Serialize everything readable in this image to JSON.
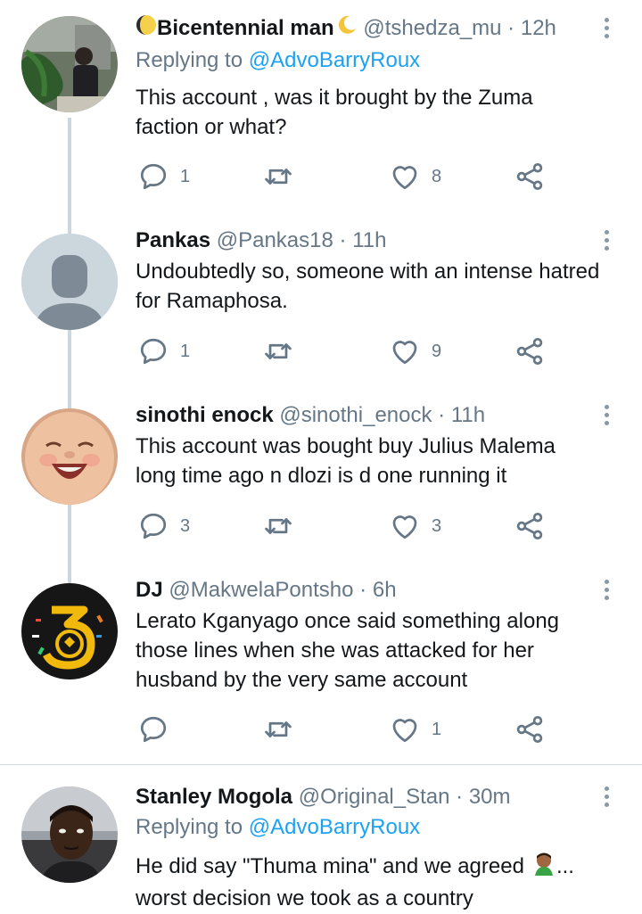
{
  "tweets": [
    {
      "name": "Bicentennial man",
      "name_prefix_icon": "yellow-half-moon-icon",
      "name_suffix_icon": "crescent-moon-icon",
      "handle": "@tshedza_mu",
      "time": "12h",
      "replying_label": "Replying to",
      "replying_to": "@AdvoBarryRoux",
      "text": "This account , was it brought by the Zuma faction or what?",
      "reply_count": "1",
      "retweet_count": "",
      "like_count": "8"
    },
    {
      "name": "Pankas",
      "handle": "@Pankas18",
      "time": "11h",
      "text": "Undoubtedly so, someone with an intense hatred for Ramaphosa.",
      "reply_count": "1",
      "retweet_count": "",
      "like_count": "9"
    },
    {
      "name": "sinothi enock",
      "handle": "@sinothi_enock",
      "time": "11h",
      "text": "This account was bought buy Julius Malema long time ago n dlozi is d one running it",
      "reply_count": "3",
      "retweet_count": "",
      "like_count": "3"
    },
    {
      "name": "DJ",
      "handle": "@MakwelaPontsho",
      "time": "6h",
      "text": "Lerato Kganyago once said something along those lines when she was attacked for her husband by the very same account",
      "reply_count": "",
      "retweet_count": "",
      "like_count": "1"
    },
    {
      "name": "Stanley Mogola",
      "handle": "@Original_Stan",
      "time": "30m",
      "replying_label": "Replying to",
      "replying_to": "@AdvoBarryRoux",
      "text_line1": "He did say \"Thuma mina\" and we agreed",
      "text_emoji": "man-facepalming-emoji",
      "text_line1_suffix": "...",
      "text_line2": "worst decision we took as a country"
    }
  ],
  "separator": "·",
  "colors": {
    "text": "#14171a",
    "secondary": "#657786",
    "link": "#1da1f2",
    "thread_line": "#ccd6dd",
    "icon": "#657786"
  }
}
